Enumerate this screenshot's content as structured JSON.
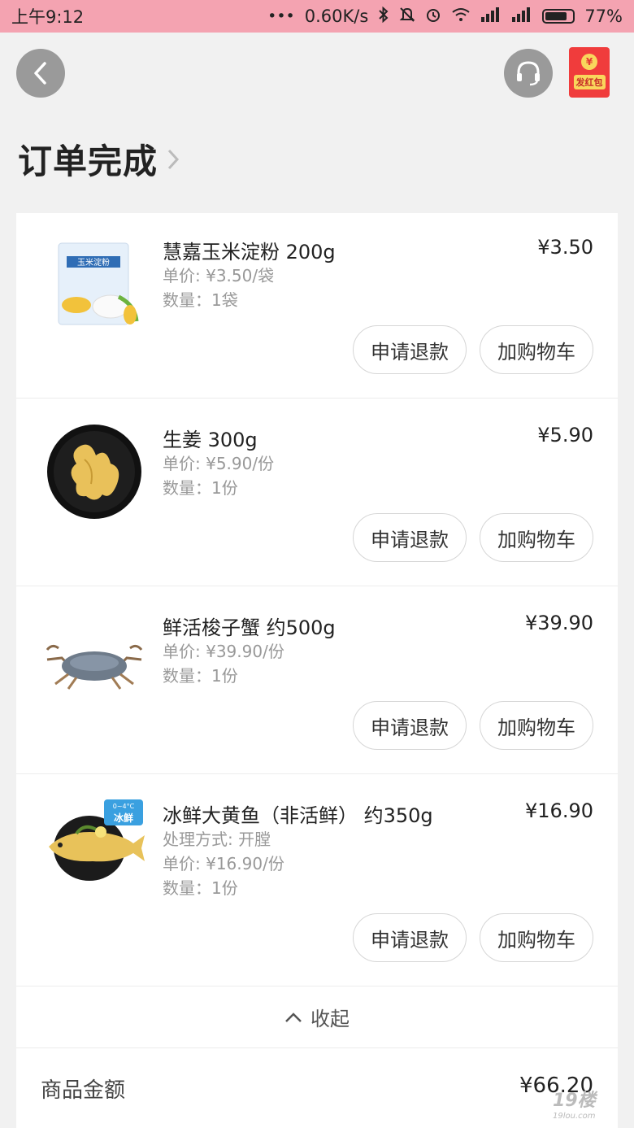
{
  "status_bar": {
    "time": "上午9:12",
    "dots": "•••",
    "network_speed": "0.60K/s",
    "battery": "77%"
  },
  "header": {
    "red_packet_label": "发红包",
    "red_packet_coin": "¥"
  },
  "page_title": "订单完成",
  "items": [
    {
      "name": "慧嘉玉米淀粉 200g",
      "price": "¥3.50",
      "unit_price": "单价: ¥3.50/袋",
      "quantity": "数量：1袋",
      "refund_label": "申请退款",
      "cart_label": "加购物车"
    },
    {
      "name": "生姜 300g",
      "price": "¥5.90",
      "unit_price": "单价: ¥5.90/份",
      "quantity": "数量：1份",
      "refund_label": "申请退款",
      "cart_label": "加购物车"
    },
    {
      "name": "鲜活梭子蟹 约500g",
      "price": "¥39.90",
      "unit_price": "单价: ¥39.90/份",
      "quantity": "数量：1份",
      "refund_label": "申请退款",
      "cart_label": "加购物车"
    },
    {
      "name": "冰鲜大黄鱼（非活鲜） 约350g",
      "price": "¥16.90",
      "processing": "处理方式: 开膛",
      "unit_price": "单价: ¥16.90/份",
      "quantity": "数量：1份",
      "refund_label": "申请退款",
      "cart_label": "加购物车",
      "badge_temp": "0~4°C",
      "badge_text": "冰鲜"
    }
  ],
  "collapse_label": "收起",
  "summary": {
    "goods_amount_label": "商品金额",
    "goods_amount_value": "¥66.20"
  },
  "watermark": "19楼",
  "watermark_sub": "19lou.com"
}
